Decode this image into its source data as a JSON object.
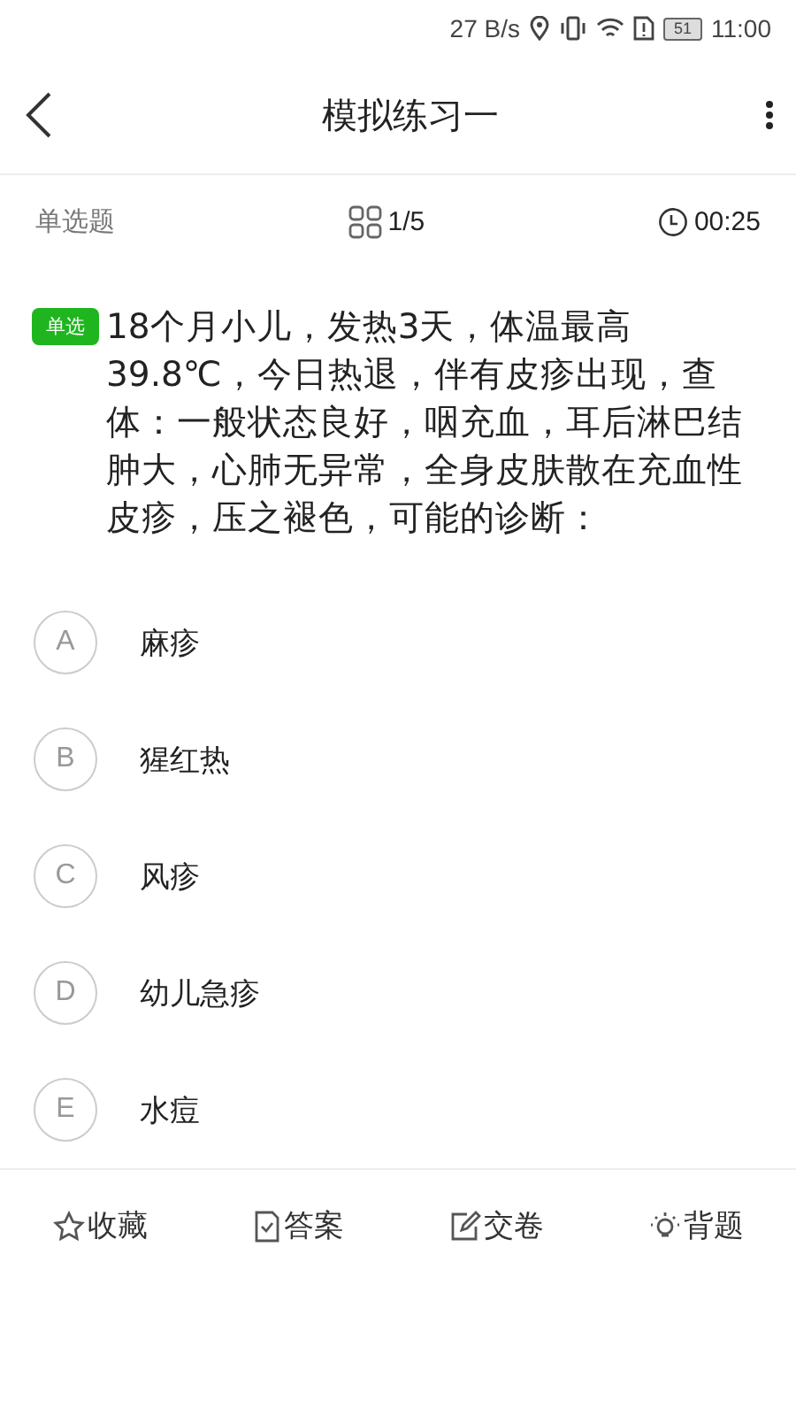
{
  "status_bar": {
    "speed": "27 B/s",
    "battery": "51",
    "time": "11:00"
  },
  "header": {
    "title": "模拟练习一"
  },
  "info_bar": {
    "type": "单选题",
    "progress": "1/5",
    "timer": "00:25"
  },
  "question": {
    "badge": "单选",
    "text": "18个月小儿，发热3天，体温最高39.8℃，今日热退，伴有皮疹出现，查体：一般状态良好，咽充血，耳后淋巴结肿大，心肺无异常，全身皮肤散在充血性皮疹，压之褪色，可能的诊断："
  },
  "options": [
    {
      "letter": "A",
      "text": "麻疹",
      "selected": false
    },
    {
      "letter": "B",
      "text": "猩红热",
      "selected": false
    },
    {
      "letter": "C",
      "text": "风疹",
      "selected": false
    },
    {
      "letter": "D",
      "text": "幼儿急疹",
      "selected": false
    },
    {
      "letter": "E",
      "text": "水痘",
      "selected": false
    }
  ],
  "bottom_bar": [
    {
      "kind": "star",
      "label": "收藏"
    },
    {
      "kind": "answer",
      "label": "答案"
    },
    {
      "kind": "submit",
      "label": "交卷"
    },
    {
      "kind": "bulb",
      "label": "背题"
    }
  ]
}
